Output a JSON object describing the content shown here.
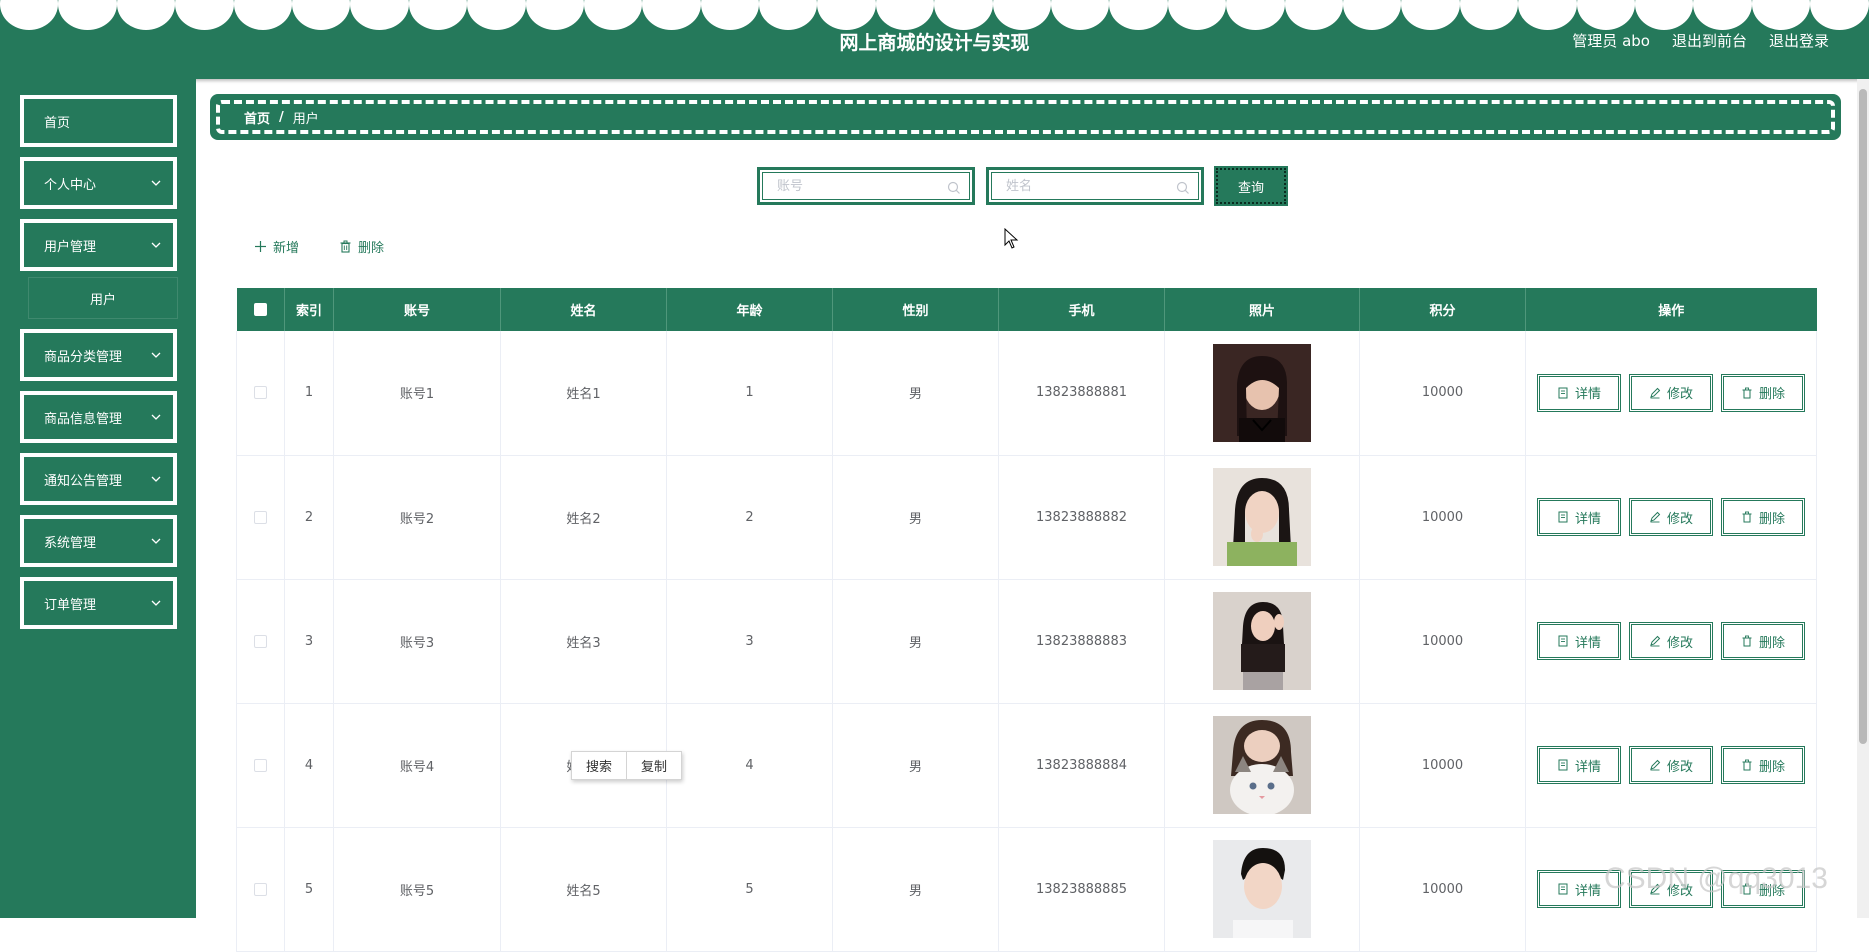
{
  "header": {
    "title": "网上商城的设计与实现",
    "admin_label": "管理员 abo",
    "to_front_label": "退出到前台",
    "logout_label": "退出登录"
  },
  "sidebar": {
    "items": [
      {
        "label": "首页",
        "has_arrow": false
      },
      {
        "label": "个人中心",
        "has_arrow": true
      },
      {
        "label": "用户管理",
        "has_arrow": true
      },
      {
        "label": "商品分类管理",
        "has_arrow": true
      },
      {
        "label": "商品信息管理",
        "has_arrow": true
      },
      {
        "label": "通知公告管理",
        "has_arrow": true
      },
      {
        "label": "系统管理",
        "has_arrow": true
      },
      {
        "label": "订单管理",
        "has_arrow": true
      }
    ],
    "submenu": {
      "label": "用户"
    }
  },
  "breadcrumb": {
    "home": "首页",
    "separator": "/",
    "current": "用户"
  },
  "search": {
    "account_placeholder": "账号",
    "name_placeholder": "姓名",
    "query_label": "查询"
  },
  "toolbar": {
    "add_label": "新增",
    "delete_label": "删除"
  },
  "table": {
    "headers": [
      "索引",
      "账号",
      "姓名",
      "年龄",
      "性别",
      "手机",
      "照片",
      "积分",
      "操作"
    ],
    "rows": [
      {
        "index": "1",
        "account": "账号1",
        "name": "姓名1",
        "age": "1",
        "gender": "男",
        "phone": "13823888881",
        "points": "10000"
      },
      {
        "index": "2",
        "account": "账号2",
        "name": "姓名2",
        "age": "2",
        "gender": "男",
        "phone": "13823888882",
        "points": "10000"
      },
      {
        "index": "3",
        "account": "账号3",
        "name": "姓名3",
        "age": "3",
        "gender": "男",
        "phone": "13823888883",
        "points": "10000"
      },
      {
        "index": "4",
        "account": "账号4",
        "name": "姓名4",
        "age": "4",
        "gender": "男",
        "phone": "13823888884",
        "points": "10000"
      },
      {
        "index": "5",
        "account": "账号5",
        "name": "姓名5",
        "age": "5",
        "gender": "男",
        "phone": "13823888885",
        "points": "10000"
      }
    ],
    "actions": {
      "detail": "详情",
      "edit": "修改",
      "delete": "删除"
    }
  },
  "context_menu": {
    "search": "搜索",
    "copy": "复制"
  },
  "watermark": "CSDN @qq3013",
  "colors": {
    "primary": "#25795b",
    "white": "#ffffff"
  }
}
